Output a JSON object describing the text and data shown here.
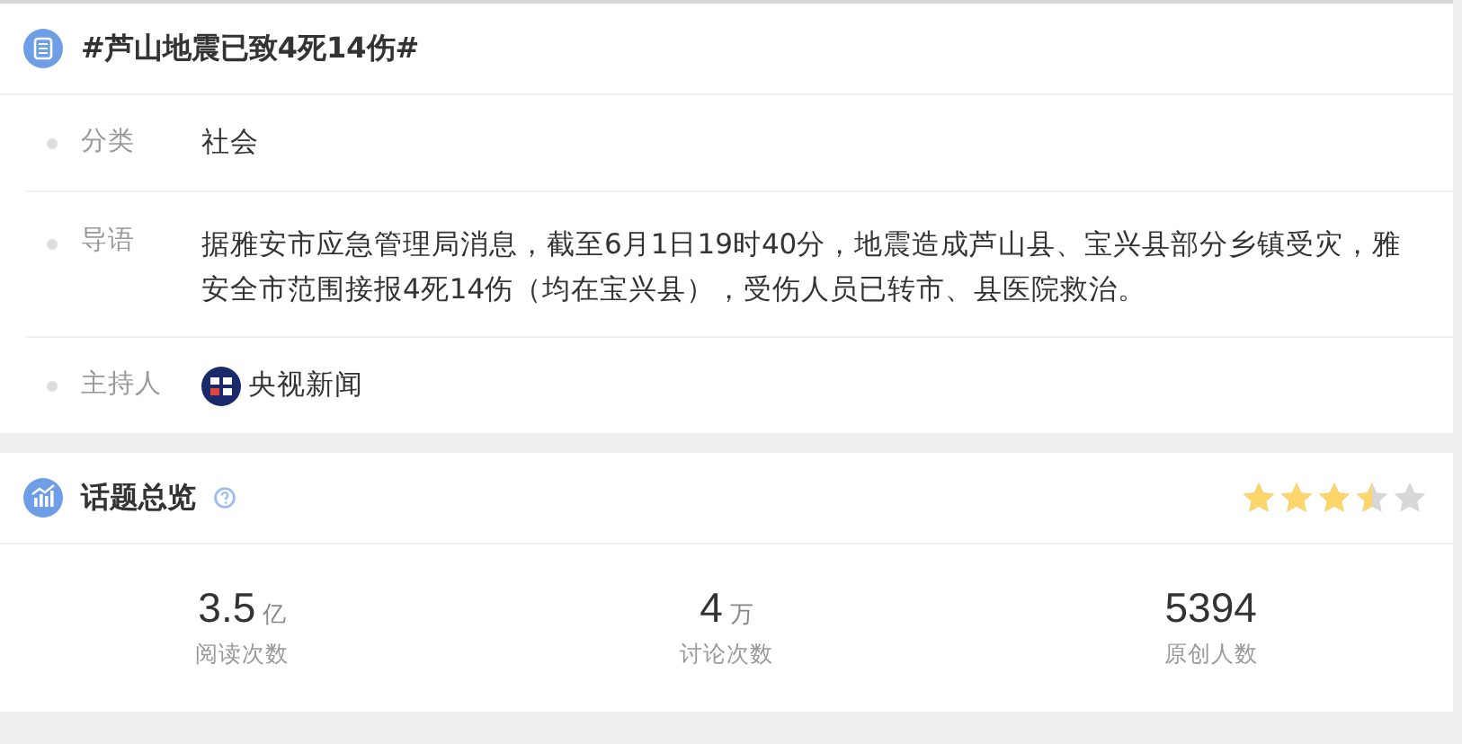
{
  "topic": {
    "title": "#芦山地震已致4死14伤#",
    "fields": [
      {
        "kind": "text",
        "label": "分类",
        "value": "社会"
      },
      {
        "kind": "text",
        "label": "导语",
        "value": "据雅安市应急管理局消息，截至6月1日19时40分，地震造成芦山县、宝兴县部分乡镇受灾，雅安全市范围接报4死14伤（均在宝兴县），受伤人员已转市、县医院救治。"
      },
      {
        "kind": "host",
        "label": "主持人",
        "value": "央视新闻"
      }
    ]
  },
  "overview": {
    "title": "话题总览",
    "stars": 3.5,
    "stats": [
      {
        "number": "3.5",
        "unit": "亿",
        "label": "阅读次数"
      },
      {
        "number": "4",
        "unit": "万",
        "label": "讨论次数"
      },
      {
        "number": "5394",
        "label": "原创人数"
      }
    ]
  }
}
